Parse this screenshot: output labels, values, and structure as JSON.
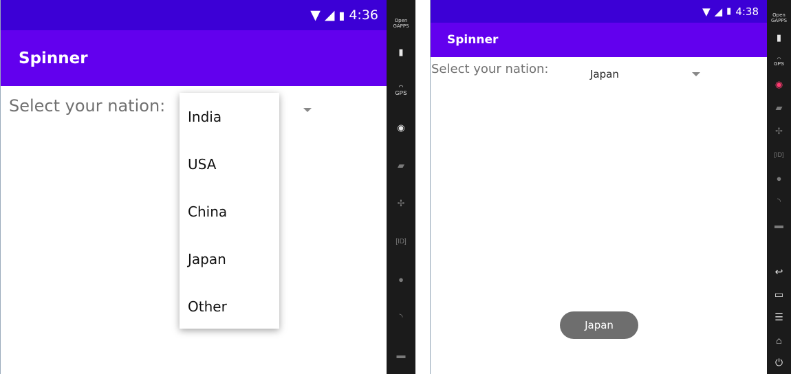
{
  "left": {
    "status": {
      "time": "4:36",
      "icons": [
        "wifi-icon",
        "signal-icon",
        "battery-icon"
      ]
    },
    "title": "Spinner",
    "prompt": "Select your nation:",
    "dropdown_options": [
      "India",
      "USA",
      "China",
      "Japan",
      "Other"
    ]
  },
  "right": {
    "status": {
      "time": "4:38",
      "icons": [
        "wifi-icon",
        "signal-icon",
        "battery-icon"
      ]
    },
    "title": "Spinner",
    "prompt": "Select your nation:",
    "selected": "Japan",
    "toast": "Japan"
  },
  "emulator": {
    "label_line1": "Open",
    "label_line2": "GAPPS",
    "gps_label": "GPS",
    "id_label": "ID",
    "icons": [
      "battery-icon",
      "gps-icon",
      "camera-icon",
      "video-icon",
      "move-icon",
      "id-icon",
      "location-icon",
      "rss-icon",
      "message-icon"
    ],
    "nav_icons": [
      "back-icon",
      "recents-icon",
      "menu-icon",
      "home-icon",
      "power-icon"
    ]
  },
  "colors": {
    "status_bar": "#3c00d6",
    "app_bar": "#6200ee",
    "toast": "#6e6e6e",
    "emulator_panel": "#1b1b1b"
  }
}
